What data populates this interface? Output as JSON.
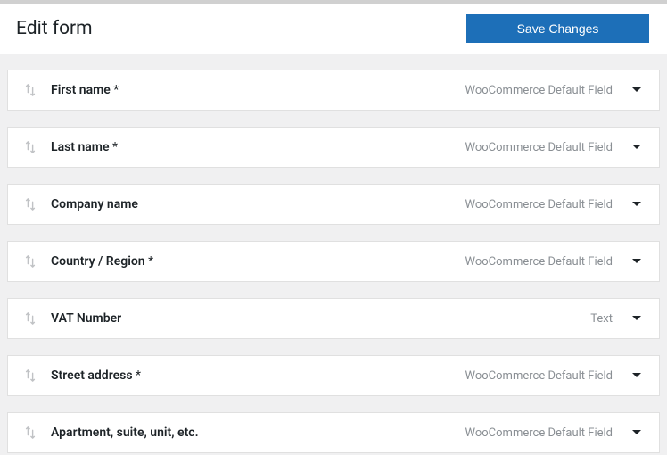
{
  "header": {
    "title": "Edit form",
    "save_label": "Save Changes"
  },
  "type_labels": {
    "default": "WooCommerce Default Field",
    "text": "Text"
  },
  "fields": [
    {
      "label": "First name",
      "required": true,
      "type": "default"
    },
    {
      "label": "Last name",
      "required": true,
      "type": "default"
    },
    {
      "label": "Company name",
      "required": false,
      "type": "default"
    },
    {
      "label": "Country / Region",
      "required": true,
      "type": "default"
    },
    {
      "label": "VAT Number",
      "required": false,
      "type": "text"
    },
    {
      "label": "Street address",
      "required": true,
      "type": "default"
    },
    {
      "label": "Apartment, suite, unit, etc.",
      "required": false,
      "type": "default"
    }
  ]
}
